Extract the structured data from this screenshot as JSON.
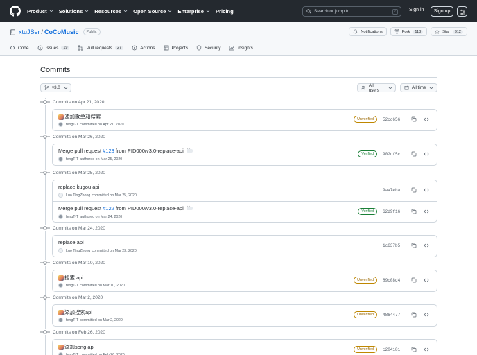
{
  "header": {
    "nav": [
      "Product",
      "Solutions",
      "Resources",
      "Open Source",
      "Enterprise",
      "Pricing"
    ],
    "search_placeholder": "Search or jump to...",
    "search_kbd": "/",
    "sign_in": "Sign in",
    "sign_up": "Sign up"
  },
  "repo": {
    "owner": "xtuJSer",
    "name": "CoCoMusic",
    "visibility": "Public",
    "notifications": "Notifications",
    "fork_label": "Fork",
    "fork_count": "113",
    "star_label": "Star",
    "star_count": "912"
  },
  "tabs": [
    {
      "label": "Code",
      "icon": "code-icon"
    },
    {
      "label": "Issues",
      "count": "19",
      "icon": "issue-icon"
    },
    {
      "label": "Pull requests",
      "count": "27",
      "icon": "pull-request-icon"
    },
    {
      "label": "Actions",
      "icon": "play-icon"
    },
    {
      "label": "Projects",
      "icon": "table-icon"
    },
    {
      "label": "Security",
      "icon": "shield-icon"
    },
    {
      "label": "Insights",
      "icon": "graph-icon"
    }
  ],
  "page": {
    "title": "Commits",
    "branch": "v3.0",
    "users_filter": "All users",
    "time_filter": "All time"
  },
  "groups": [
    {
      "date": "Commits on Apr 21, 2020",
      "commits": [
        {
          "msg": "添加歌单和搜索",
          "emoji": true,
          "author": "fengT-T",
          "action": "committed on Apr 21, 2020",
          "badge": "Unverified",
          "sha": "52cc656"
        }
      ]
    },
    {
      "date": "Commits on Mar 26, 2020",
      "commits": [
        {
          "msg_pre": "Merge pull request",
          "pr": "#123",
          "msg_post": "from PID000/v3.0-replace-api",
          "ellipsis": true,
          "author": "fengT-T",
          "action": "authored on Mar 25, 2020",
          "badge": "Verified",
          "sha": "902df5c"
        }
      ]
    },
    {
      "date": "Commits on Mar 25, 2020",
      "commits": [
        {
          "msg": "replace kugou api",
          "author": "Luo TingZhong",
          "action": "committed on Mar 25, 2020",
          "avatar_light": true,
          "sha": "9aa7eba"
        },
        {
          "msg_pre": "Merge pull request",
          "pr": "#122",
          "msg_post": "from PID000/v3.0-replace-api",
          "ellipsis": true,
          "author": "fengT-T",
          "action": "authored on Mar 24, 2020",
          "badge": "Verified",
          "sha": "62d9f16"
        }
      ]
    },
    {
      "date": "Commits on Mar 24, 2020",
      "commits": [
        {
          "msg": "replace api",
          "author": "Luo TingZhong",
          "action": "committed on Mar 23, 2020",
          "avatar_light": true,
          "sha": "1c637b5"
        }
      ]
    },
    {
      "date": "Commits on Mar 10, 2020",
      "commits": [
        {
          "msg": "搜索 api",
          "emoji": true,
          "author": "fengT-T",
          "action": "committed on Mar 10, 2020",
          "badge": "Unverified",
          "sha": "89c08d4"
        }
      ]
    },
    {
      "date": "Commits on Mar 2, 2020",
      "commits": [
        {
          "msg": "添加搜索api",
          "emoji": true,
          "author": "fengT-T",
          "action": "committed on Mar 2, 2020",
          "badge": "Unverified",
          "sha": "4864477"
        }
      ]
    },
    {
      "date": "Commits on Feb 26, 2020",
      "commits": [
        {
          "msg": "添加song api",
          "emoji": true,
          "author": "fengT-T",
          "action": "committed on Feb 26, 2020",
          "badge": "Unverified",
          "sha": "c204181"
        }
      ]
    }
  ]
}
